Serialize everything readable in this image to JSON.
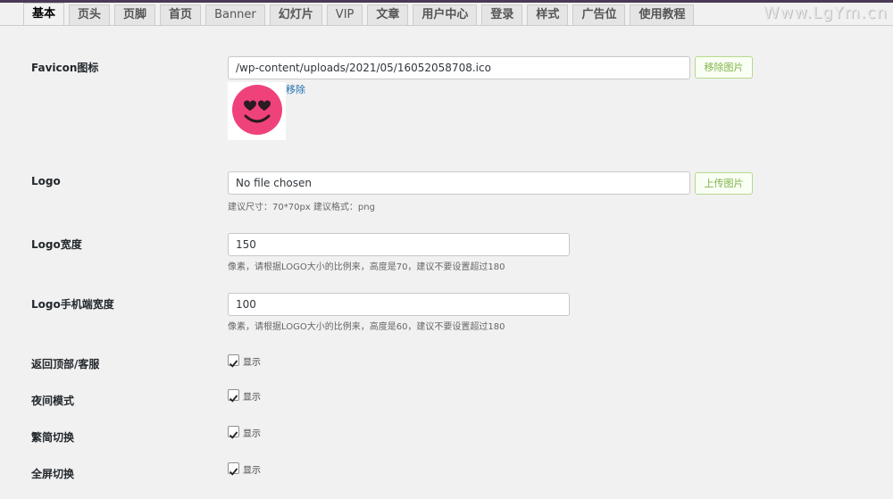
{
  "tabs": [
    "基本",
    "页头",
    "页脚",
    "首页",
    "Banner",
    "幻灯片",
    "VIP",
    "文章",
    "用户中心",
    "登录",
    "样式",
    "广告位",
    "使用教程"
  ],
  "watermark": "Www.LgYm.cn",
  "favicon": {
    "label": "Favicon图标",
    "value": "/wp-content/uploads/2021/05/16052058708.ico",
    "button": "移除图片",
    "remove_link": "移除"
  },
  "logo": {
    "label": "Logo",
    "value": "No file chosen",
    "button": "上传图片",
    "hint": "建议尺寸：70*70px 建议格式：png"
  },
  "logo_width": {
    "label": "Logo宽度",
    "value": "150",
    "hint": "像素，请根据LOGO大小的比例来，高度是70，建议不要设置超过180"
  },
  "logo_mobile_width": {
    "label": "Logo手机端宽度",
    "value": "100",
    "hint": "像素，请根据LOGO大小的比例来，高度是60，建议不要设置超过180"
  },
  "toggles": [
    {
      "label": "返回顶部/客服",
      "option": "显示",
      "checked": true
    },
    {
      "label": "夜间模式",
      "option": "显示",
      "checked": true
    },
    {
      "label": "繁简切换",
      "option": "显示",
      "checked": true
    },
    {
      "label": "全屏切换",
      "option": "显示",
      "checked": true
    }
  ],
  "colors": {
    "accent_green": "#82b34a",
    "favicon_pink": "#f0427a",
    "link_blue": "#2271b1"
  }
}
